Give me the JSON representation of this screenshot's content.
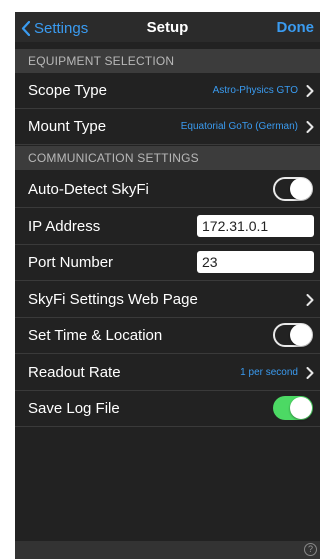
{
  "nav": {
    "back_label": "Settings",
    "title": "Setup",
    "done_label": "Done"
  },
  "sections": {
    "equipment": "EQUIPMENT SELECTION",
    "communication": "COMMUNICATION SETTINGS"
  },
  "rows": {
    "scope_type": {
      "label": "Scope Type",
      "value": "Astro-Physics GTO"
    },
    "mount_type": {
      "label": "Mount Type",
      "value": "Equatorial GoTo (German)"
    },
    "auto_detect": {
      "label": "Auto-Detect SkyFi",
      "toggle": "off"
    },
    "ip_address": {
      "label": "IP Address",
      "value": "172.31.0.1"
    },
    "port_number": {
      "label": "Port Number",
      "value": "23"
    },
    "web_page": {
      "label": "SkyFi Settings Web Page"
    },
    "set_time": {
      "label": "Set Time & Location",
      "toggle": "off"
    },
    "readout_rate": {
      "label": "Readout Rate",
      "value": "1 per second"
    },
    "save_log": {
      "label": "Save Log File",
      "toggle": "on"
    }
  },
  "footer": {
    "help_glyph": "?"
  },
  "colors": {
    "accent": "#3a9bf0",
    "background": "#222222",
    "section_header": "#3c3c3c",
    "toggle_on": "#4cd964"
  }
}
